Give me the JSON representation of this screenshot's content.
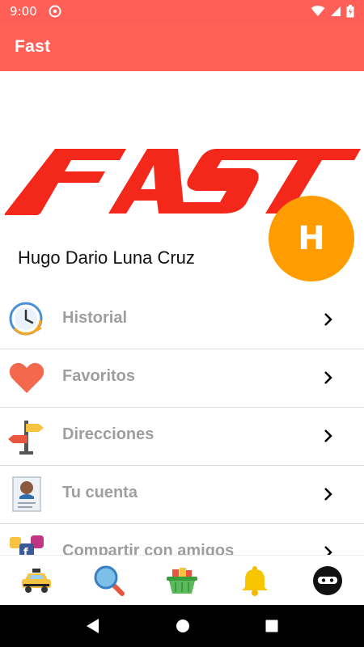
{
  "status_bar": {
    "time": "9:00",
    "icons": [
      "do-not-disturb-icon",
      "wifi-icon",
      "signal-icon",
      "battery-icon"
    ]
  },
  "app_bar": {
    "title": "Fast"
  },
  "header": {
    "logo_text": "FAST",
    "user_name": "Hugo Dario Luna Cruz",
    "avatar_initial": "H",
    "avatar_color": "#ff9d00"
  },
  "menu": {
    "items": [
      {
        "label": "Historial",
        "icon": "clock-history-icon"
      },
      {
        "label": "Favoritos",
        "icon": "heart-icon"
      },
      {
        "label": "Direcciones",
        "icon": "signpost-icon"
      },
      {
        "label": "Tu cuenta",
        "icon": "account-card-icon"
      },
      {
        "label": "Compartir con amigos",
        "icon": "social-share-icon"
      }
    ]
  },
  "bottom_nav": {
    "items": [
      "taxi-icon",
      "search-icon",
      "basket-icon",
      "bell-icon",
      "ninja-icon"
    ]
  },
  "colors": {
    "primary": "#ff6157",
    "status_bar": "#ff5f57",
    "logo_red": "#f4271b",
    "menu_label": "#9e9e9e"
  }
}
